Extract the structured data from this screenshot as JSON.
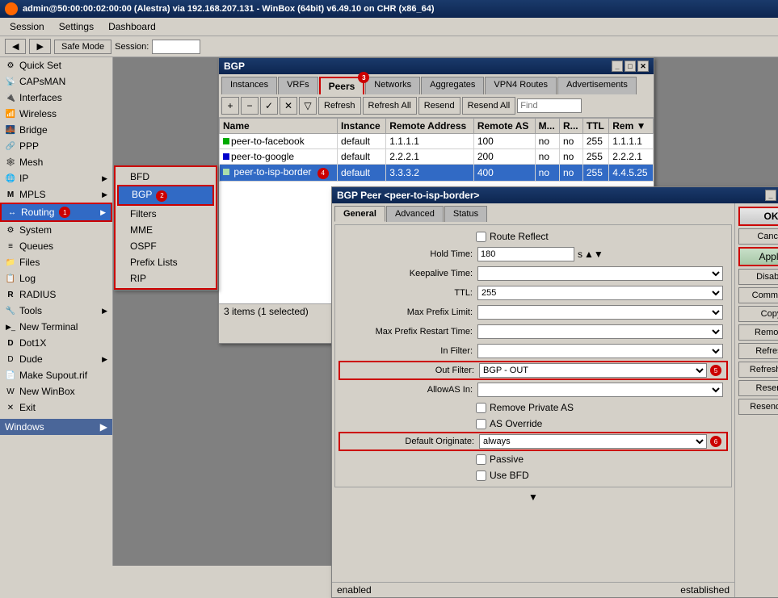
{
  "titlebar": {
    "text": "admin@50:00:00:02:00:00 (Alestra) via 192.168.207.131 - WinBox (64bit) v6.49.10 on CHR (x86_64)"
  },
  "menubar": {
    "items": [
      "Session",
      "Settings",
      "Dashboard"
    ]
  },
  "toolbar": {
    "back_label": "◀",
    "forward_label": "▶",
    "safe_mode_label": "Safe Mode",
    "session_label": "Session:"
  },
  "sidebar": {
    "items": [
      {
        "label": "Quick Set",
        "icon": "⚙",
        "has_arrow": false
      },
      {
        "label": "CAPsMAN",
        "icon": "📡",
        "has_arrow": false
      },
      {
        "label": "Interfaces",
        "icon": "🔌",
        "has_arrow": false
      },
      {
        "label": "Wireless",
        "icon": "📶",
        "has_arrow": false
      },
      {
        "label": "Bridge",
        "icon": "🌉",
        "has_arrow": false
      },
      {
        "label": "PPP",
        "icon": "🔗",
        "has_arrow": false
      },
      {
        "label": "Mesh",
        "icon": "🕸",
        "has_arrow": false
      },
      {
        "label": "IP",
        "icon": "🌐",
        "has_arrow": true
      },
      {
        "label": "MPLS",
        "icon": "M",
        "has_arrow": true
      },
      {
        "label": "Routing",
        "icon": "↔",
        "has_arrow": true,
        "active": true
      },
      {
        "label": "System",
        "icon": "⚙",
        "has_arrow": false
      },
      {
        "label": "Queues",
        "icon": "≡",
        "has_arrow": false
      },
      {
        "label": "Files",
        "icon": "📁",
        "has_arrow": false
      },
      {
        "label": "Log",
        "icon": "📋",
        "has_arrow": false
      },
      {
        "label": "RADIUS",
        "icon": "R",
        "has_arrow": false
      },
      {
        "label": "Tools",
        "icon": "🔧",
        "has_arrow": true
      },
      {
        "label": "New Terminal",
        "icon": ">_",
        "has_arrow": false
      },
      {
        "label": "Dot1X",
        "icon": "D",
        "has_arrow": false
      },
      {
        "label": "Dude",
        "icon": "D",
        "has_arrow": true
      },
      {
        "label": "Make Supout.rif",
        "icon": "📄",
        "has_arrow": false
      },
      {
        "label": "New WinBox",
        "icon": "W",
        "has_arrow": false
      },
      {
        "label": "Exit",
        "icon": "✕",
        "has_arrow": false
      }
    ]
  },
  "submenu": {
    "items": [
      "BFD",
      "BGP",
      "Filters",
      "MME",
      "OSPF",
      "Prefix Lists",
      "RIP"
    ],
    "selected": "BGP"
  },
  "bgp_window": {
    "title": "BGP",
    "tabs": [
      "Instances",
      "VRFs",
      "Peers",
      "Networks",
      "Aggregates",
      "VPN4 Routes",
      "Advertisements"
    ],
    "active_tab": "Peers",
    "toolbar_buttons": [
      "Refresh",
      "Refresh All",
      "Resend",
      "Resend All"
    ],
    "find_placeholder": "Find",
    "columns": [
      "Name",
      "Instance",
      "Remote Address",
      "Remote AS",
      "M...",
      "R...",
      "TTL",
      "Rem ▼"
    ],
    "rows": [
      {
        "name": "peer-to-facebook",
        "instance": "default",
        "remote_address": "1.1.1.1",
        "remote_as": "100",
        "m": "no",
        "r": "no",
        "ttl": "255",
        "rem": "1.1.1.1"
      },
      {
        "name": "peer-to-google",
        "instance": "default",
        "remote_address": "2.2.2.1",
        "remote_as": "200",
        "m": "no",
        "r": "no",
        "ttl": "255",
        "rem": "2.2.2.1"
      },
      {
        "name": "peer-to-isp-border",
        "instance": "default",
        "remote_address": "3.3.3.2",
        "remote_as": "400",
        "m": "no",
        "r": "no",
        "ttl": "255",
        "rem": "4.4.5.25",
        "selected": true
      }
    ],
    "status": "3 items (1 selected)"
  },
  "peer_dialog": {
    "title": "BGP Peer <peer-to-isp-border>",
    "tabs": [
      "General",
      "Advanced",
      "Status"
    ],
    "active_tab": "General",
    "fields": {
      "route_reflect_label": "Route Reflect",
      "hold_time_label": "Hold Time:",
      "hold_time_value": "180",
      "hold_time_unit": "s",
      "keepalive_time_label": "Keepalive Time:",
      "ttl_label": "TTL:",
      "ttl_value": "255",
      "max_prefix_limit_label": "Max Prefix Limit:",
      "max_prefix_restart_label": "Max Prefix Restart Time:",
      "in_filter_label": "In Filter:",
      "out_filter_label": "Out Filter:",
      "out_filter_value": "BGP - OUT",
      "allow_as_in_label": "AllowAS In:",
      "remove_private_as_label": "Remove Private AS",
      "as_override_label": "AS Override",
      "default_originate_label": "Default Originate:",
      "default_originate_value": "always",
      "passive_label": "Passive",
      "use_bfd_label": "Use BFD"
    },
    "buttons": [
      "OK",
      "Cancel",
      "Apply",
      "Disable",
      "Comment",
      "Copy",
      "Remove",
      "Refresh",
      "Refresh All",
      "Resend",
      "Resend All"
    ],
    "status_left": "enabled",
    "status_right": "established"
  },
  "annotations": {
    "1": "Routing menu item",
    "2": "BGP submenu item",
    "3": "Peers tab",
    "4": "peer-to-isp-border row selected",
    "5": "Out Filter field",
    "6": "Default Originate field",
    "7": "Apply button",
    "8": "OK button"
  }
}
